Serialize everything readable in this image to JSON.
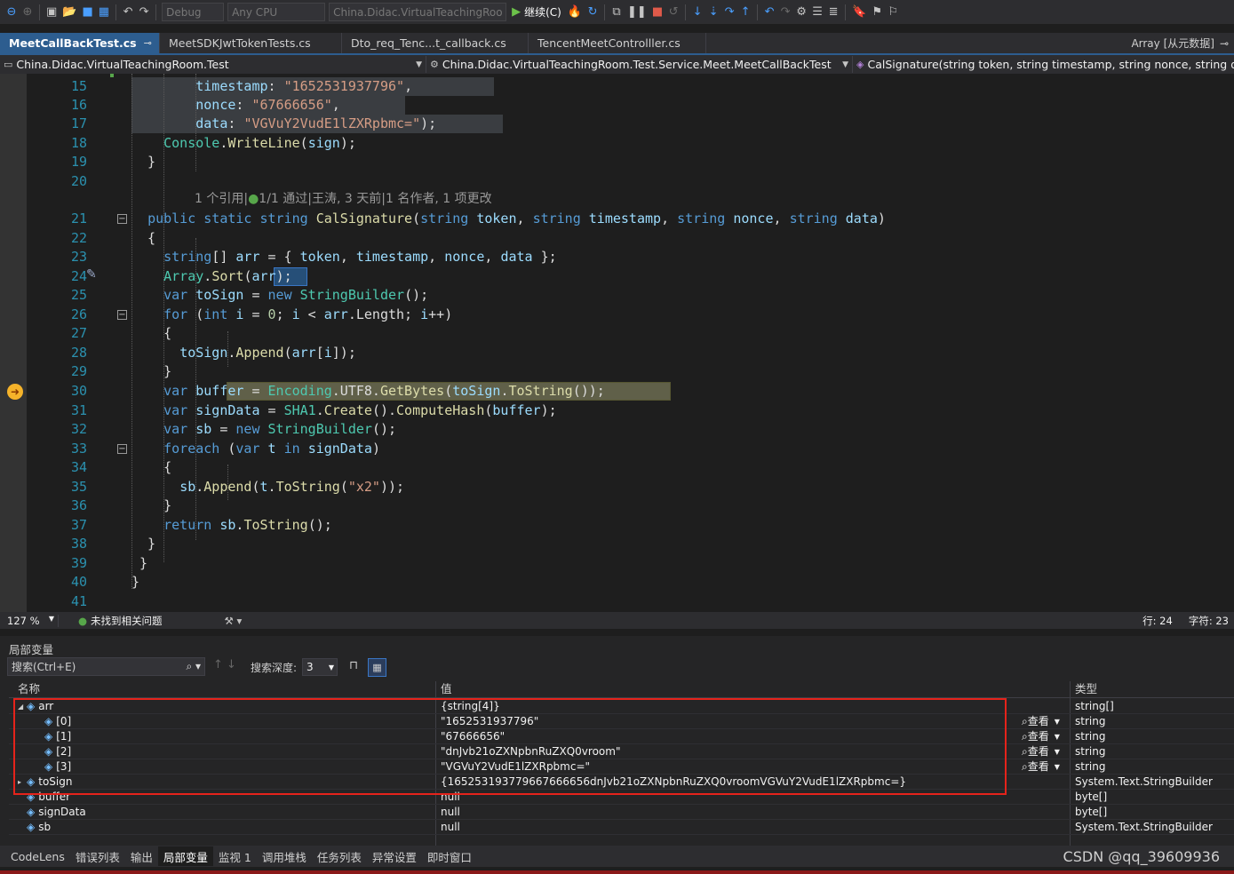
{
  "toolbar": {
    "config": "Debug",
    "platform": "Any CPU",
    "startup_project": "China.Didac.VirtualTeachingRoo",
    "continue_label": "继续(C)"
  },
  "tabs": [
    {
      "label": "MeetCallBackTest.cs"
    },
    {
      "label": "MeetSDKJwtTokenTests.cs"
    },
    {
      "label": "Dto_req_Tenc...t_callback.cs"
    },
    {
      "label": "TencentMeetControlller.cs"
    }
  ],
  "tab_right_label": "Array [从元数据]",
  "nav": {
    "project": "China.Didac.VirtualTeachingRoom.Test",
    "type": "China.Didac.VirtualTeachingRoom.Test.Service.Meet.MeetCallBackTest",
    "member": "CalSignature(string token, string timestamp, string nonce, string data)"
  },
  "line_numbers": [
    "15",
    "16",
    "17",
    "18",
    "19",
    "20",
    "21",
    "22",
    "23",
    "24",
    "25",
    "26",
    "27",
    "28",
    "29",
    "30",
    "31",
    "32",
    "33",
    "34",
    "35",
    "36",
    "37",
    "38",
    "39",
    "40",
    "41"
  ],
  "code": {
    "l15_key": "timestamp",
    "l15_val": "\"1652531937796\"",
    "l16_key": "nonce",
    "l16_val": "\"67666656\"",
    "l17_key": "data",
    "l17_val": "\"VGVuY2VudE1lZXRpbmc=\"",
    "lens_refs": "1 个引用",
    "lens_tests": "1/1 通过",
    "lens_rest": "王涛, 3 天前|1 名作者, 1 项更改",
    "string_x2": "\"x2\"",
    "num_zero": "0"
  },
  "editor_status": {
    "zoom": "127 %",
    "issues": "未找到相关问题",
    "line": "行: 24",
    "col": "字符: 23"
  },
  "locals": {
    "title": "局部变量",
    "search_placeholder": "搜索(Ctrl+E)",
    "depth_label": "搜索深度:",
    "depth_value": "3",
    "col_name": "名称",
    "col_value": "值",
    "col_type": "类型",
    "view_label": "查看",
    "rows": [
      {
        "name": "arr",
        "value": "{string[4]}",
        "type": "string[]"
      },
      {
        "name": "[0]",
        "value": "\"1652531937796\"",
        "type": "string"
      },
      {
        "name": "[1]",
        "value": "\"67666656\"",
        "type": "string"
      },
      {
        "name": "[2]",
        "value": "\"dnJvb21oZXNpbnRuZXQ0vroom\"",
        "type": "string"
      },
      {
        "name": "[3]",
        "value": "\"VGVuY2VudE1lZXRpbmc=\"",
        "type": "string"
      },
      {
        "name": "toSign",
        "value": "{165253193779667666656dnJvb21oZXNpbnRuZXQ0vroomVGVuY2VudE1lZXRpbmc=}",
        "type": "System.Text.StringBuilder"
      },
      {
        "name": "buffer",
        "value": "null",
        "type": "byte[]"
      },
      {
        "name": "signData",
        "value": "null",
        "type": "byte[]"
      },
      {
        "name": "sb",
        "value": "null",
        "type": "System.Text.StringBuilder"
      }
    ]
  },
  "bottom_tabs": [
    "CodeLens",
    "错误列表",
    "输出",
    "局部变量",
    "监视 1",
    "调用堆栈",
    "任务列表",
    "异常设置",
    "即时窗口"
  ],
  "watermark": "CSDN @qq_39609936",
  "colors": {
    "accent": "#2d5d8f",
    "highlight_box": "#e5231b",
    "exec_arrow": "#f5b32a"
  }
}
